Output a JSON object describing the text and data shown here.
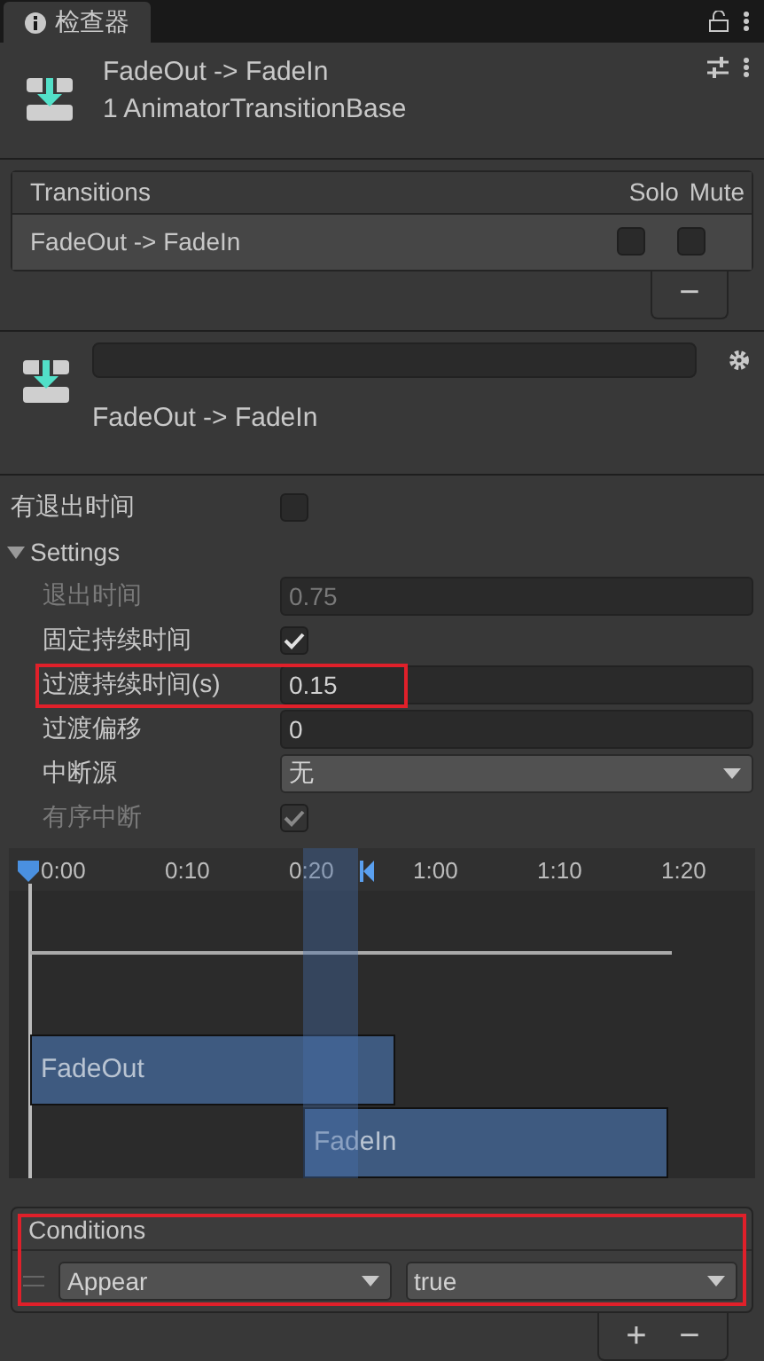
{
  "tab": {
    "title": "检查器"
  },
  "header": {
    "title": "FadeOut -> FadeIn",
    "subtitle": "1 AnimatorTransitionBase"
  },
  "transitions": {
    "title": "Transitions",
    "columns": [
      "Solo",
      "Mute"
    ],
    "rows": [
      {
        "name": "FadeOut -> FadeIn",
        "solo": false,
        "mute": false
      }
    ],
    "remove_button": "−"
  },
  "transition": {
    "label": "FadeOut -> FadeIn"
  },
  "has_exit_time": {
    "label": "有退出时间",
    "checked": false
  },
  "settings": {
    "label": "Settings",
    "expanded": true,
    "fields": [
      {
        "kind": "number",
        "label": "退出时间",
        "value": "0.75",
        "disabled": true,
        "highlighted": false
      },
      {
        "kind": "checkbox",
        "label": "固定持续时间",
        "checked": true,
        "disabled": false,
        "highlighted": false
      },
      {
        "kind": "number",
        "label": "过渡持续时间(s)",
        "value": "0.15",
        "disabled": false,
        "highlighted": true
      },
      {
        "kind": "number",
        "label": "过渡偏移",
        "value": "0",
        "disabled": false,
        "highlighted": false
      },
      {
        "kind": "dropdown",
        "label": "中断源",
        "value": "无",
        "disabled": false,
        "highlighted": false
      },
      {
        "kind": "checkbox",
        "label": "有序中断",
        "checked": true,
        "disabled": true,
        "highlighted": false
      }
    ]
  },
  "timeline": {
    "ticks": [
      "0:00",
      "0:10",
      "0:20",
      "1:00",
      "1:10",
      "1:20"
    ],
    "clips": [
      "FadeOut",
      "FadeIn"
    ]
  },
  "conditions": {
    "title": "Conditions",
    "highlighted": true,
    "rows": [
      {
        "parameter": "Appear",
        "value": "true"
      }
    ],
    "add_button": "+",
    "remove_button": "−"
  }
}
